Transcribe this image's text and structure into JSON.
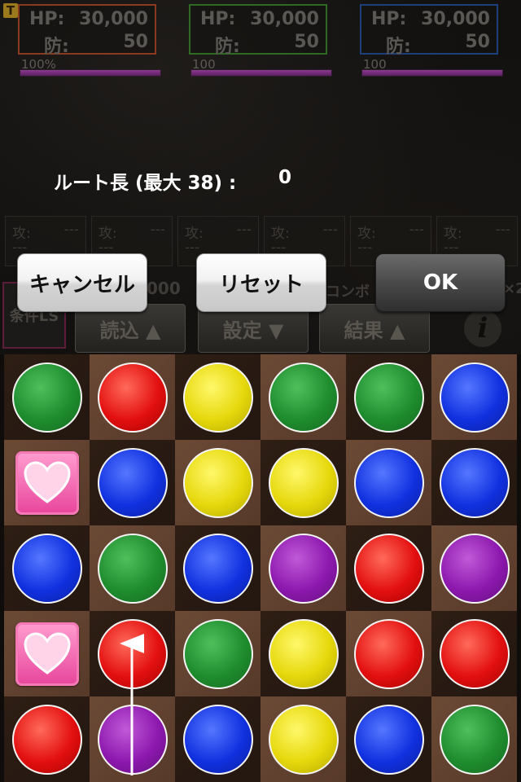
{
  "team": {
    "badge": "T",
    "panels": [
      {
        "hp_label": "HP:",
        "hp_value": "30,000",
        "def_label": "防:",
        "def_value": "50",
        "border_color": "#8a3a1e",
        "bar_label": "100%",
        "bar_percent": 100
      },
      {
        "hp_label": "HP:",
        "hp_value": "30,000",
        "def_label": "防:",
        "def_value": "50",
        "border_color": "#2f6a22",
        "bar_label": "100",
        "bar_percent": 100
      },
      {
        "hp_label": "HP:",
        "hp_value": "30,000",
        "def_label": "防:",
        "def_value": "50",
        "border_color": "#1e3f7a",
        "bar_label": "100",
        "bar_percent": 100
      }
    ]
  },
  "route": {
    "label": "ルート長 (最大 38) :",
    "value": "0"
  },
  "stat_boxes": [
    {
      "atk_label": "攻:",
      "atk_value": "---",
      "sub": "---"
    },
    {
      "atk_label": "攻:",
      "atk_value": "---",
      "sub": "---"
    },
    {
      "atk_label": "攻:",
      "atk_value": "---",
      "sub": "---"
    },
    {
      "atk_label": "攻:",
      "atk_value": "---",
      "sub": "---"
    },
    {
      "atk_label": "攻:",
      "atk_value": "---",
      "sub": "---"
    },
    {
      "atk_label": "攻:",
      "atk_value": "---",
      "sub": "---"
    }
  ],
  "hidden_texts": {
    "damage_partial": "000",
    "combo_partial": "コンボ",
    "multiplier_partial": "×2"
  },
  "dialog": {
    "cancel": "キャンセル",
    "reset": "リセット",
    "ok": "OK"
  },
  "menu": {
    "condition": "条件LS",
    "load": "読込 ▲",
    "settings": "設定 ▼",
    "result": "結果 ▲",
    "info": "i"
  },
  "board": {
    "rows": [
      [
        "green",
        "red",
        "yellow",
        "green",
        "green",
        "blue"
      ],
      [
        "heart",
        "blue",
        "yellow",
        "yellow",
        "blue",
        "blue"
      ],
      [
        "blue",
        "green",
        "blue",
        "purple",
        "red",
        "purple"
      ],
      [
        "heart",
        "red",
        "green",
        "yellow",
        "red",
        "red"
      ],
      [
        "red",
        "purple",
        "blue",
        "yellow",
        "blue",
        "green"
      ]
    ],
    "route_path": [
      [
        4,
        1
      ],
      [
        3,
        1
      ]
    ]
  },
  "colors": {
    "accent_ok": "#3a3a3a",
    "hp_bar": "#8a3a8e"
  }
}
